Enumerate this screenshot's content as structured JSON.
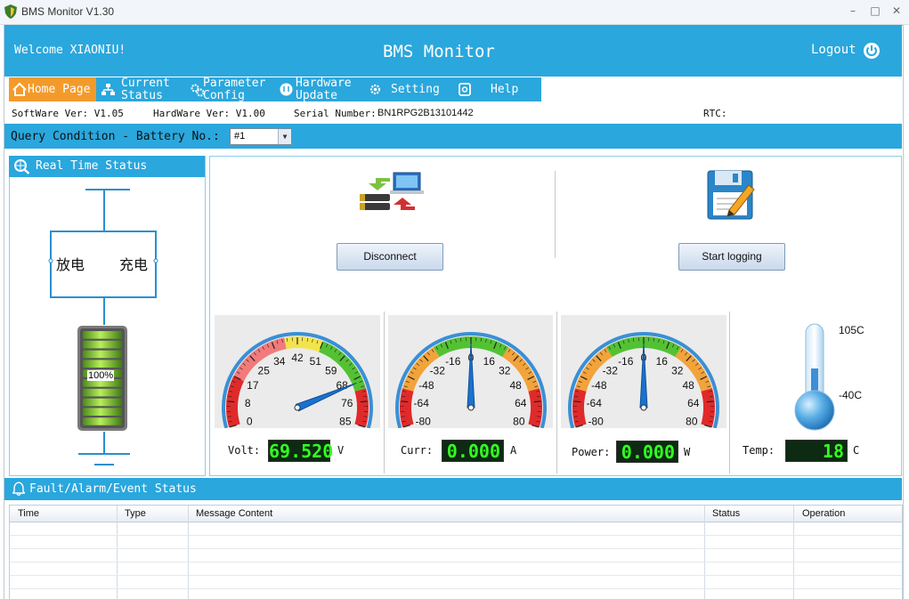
{
  "window": {
    "title": "BMS Monitor V1.30",
    "minimize": "–",
    "maximize": "□",
    "close": "✕"
  },
  "header": {
    "welcome": "Welcome XIAONIU!",
    "title": "BMS Monitor",
    "logout": "Logout",
    "accent": "#2aa7dd"
  },
  "nav": {
    "items": [
      {
        "label": "Home Page",
        "icon": "home-icon",
        "active": true
      },
      {
        "label": "Current\nStatus",
        "icon": "network-icon"
      },
      {
        "label": "Parameter\nConfig",
        "icon": "gears-icon"
      },
      {
        "label": "Hardware\nUpdate",
        "icon": "update-icon"
      },
      {
        "label": "Setting",
        "icon": "settings-icon"
      },
      {
        "label": "Help",
        "icon": "help-icon"
      }
    ],
    "active_color": "#f49a2b"
  },
  "info": {
    "software": "SoftWare Ver: V1.05",
    "hardware": "HardWare Ver: V1.00",
    "serial_label": "Serial Number:",
    "serial": "BN1RPG2B13101442",
    "rtc": "RTC:"
  },
  "query": {
    "label": "Query Condition - Battery No.:",
    "value": "#1"
  },
  "realtime": {
    "title": "Real Time Status",
    "discharge": "放电",
    "charge": "充电",
    "battery_level": "100%"
  },
  "actions": {
    "disconnect": "Disconnect",
    "start_logging": "Start logging"
  },
  "gauges": {
    "volt": {
      "ticks": [
        "0",
        "8",
        "17",
        "25",
        "34",
        "42",
        "51",
        "59",
        "68",
        "76",
        "85"
      ],
      "value": 69.52,
      "min": 0,
      "max": 85,
      "label": "Volt:",
      "display": "69.520",
      "unit": "V"
    },
    "curr": {
      "ticks": [
        "-80",
        "-64",
        "-48",
        "-32",
        "-16",
        "0",
        "16",
        "32",
        "48",
        "64",
        "80"
      ],
      "value": 0,
      "min": -80,
      "max": 80,
      "label": "Curr:",
      "display": "0.000",
      "unit": "A"
    },
    "power": {
      "ticks": [
        "-80",
        "-64",
        "-48",
        "-32",
        "-16",
        "0",
        "16",
        "32",
        "48",
        "64",
        "80"
      ],
      "value": 0,
      "min": -80,
      "max": 80,
      "label": "Power:",
      "display": "0.000",
      "unit": "W"
    }
  },
  "temp": {
    "label": "Temp:",
    "display": "18",
    "unit": "C",
    "max_label": "105C",
    "min_label": "-40C"
  },
  "fault": {
    "title": "Fault/Alarm/Event Status",
    "columns": [
      "Time",
      "Type",
      "Message Content",
      "Status",
      "Operation"
    ]
  }
}
